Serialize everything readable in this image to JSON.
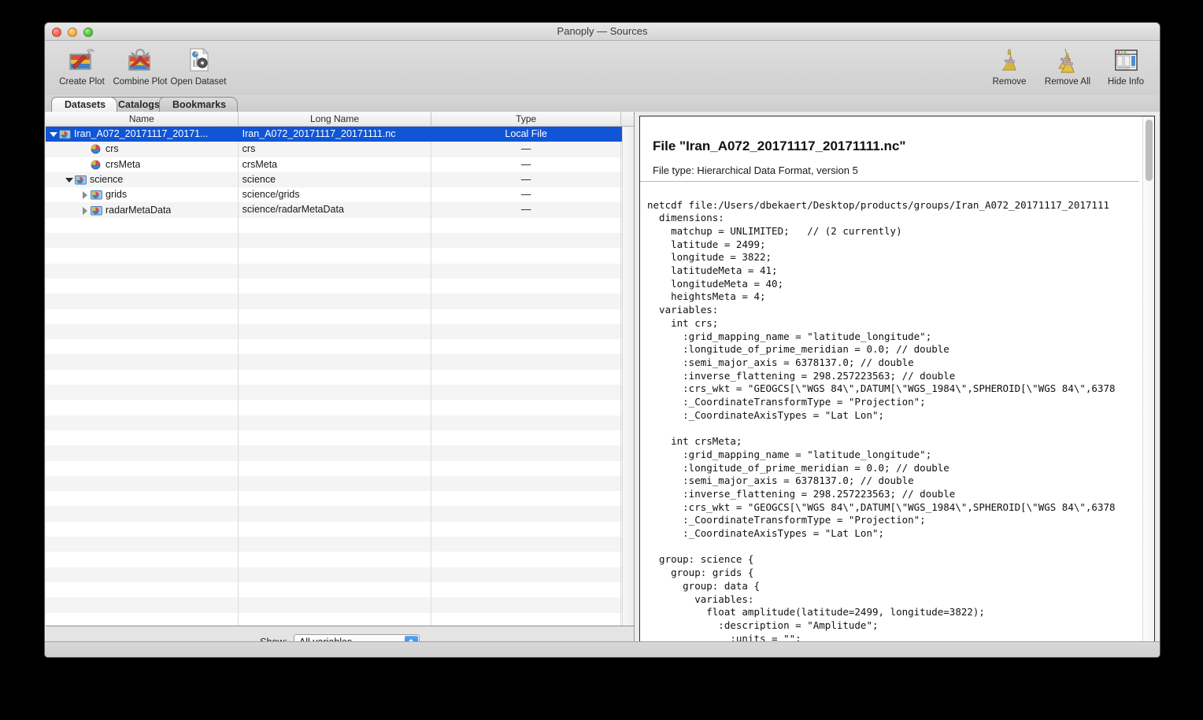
{
  "window": {
    "title": "Panoply — Sources",
    "traffic_lights": [
      "close",
      "minimize",
      "maximize"
    ]
  },
  "toolbar": {
    "left_buttons": [
      {
        "label": "Create Plot",
        "icon": "create-plot-icon"
      },
      {
        "label": "Combine Plot",
        "icon": "combine-plot-icon"
      },
      {
        "label": "Open Dataset",
        "icon": "open-dataset-icon"
      }
    ],
    "right_buttons": [
      {
        "label": "Remove",
        "icon": "broom-icon"
      },
      {
        "label": "Remove All",
        "icon": "double-broom-icon"
      },
      {
        "label": "Hide Info",
        "icon": "window-panel-icon"
      }
    ]
  },
  "tabs": [
    {
      "label": "Datasets",
      "active": true
    },
    {
      "label": "Catalogs",
      "active": false
    },
    {
      "label": "Bookmarks",
      "active": false
    }
  ],
  "table": {
    "columns": [
      "Name",
      "Long Name",
      "Type"
    ],
    "rows": [
      {
        "name": "Iran_A072_20171117_20171...",
        "long_name": "Iran_A072_20171117_20171111.nc",
        "type": "Local File",
        "depth": 0,
        "twisty": "down",
        "icon": "dataset-folder-icon",
        "selected": true
      },
      {
        "name": "crs",
        "long_name": "crs",
        "type": "—",
        "depth": 2,
        "twisty": "none",
        "icon": "variable-globe-icon",
        "selected": false
      },
      {
        "name": "crsMeta",
        "long_name": "crsMeta",
        "type": "—",
        "depth": 2,
        "twisty": "none",
        "icon": "variable-globe-icon",
        "selected": false
      },
      {
        "name": "science",
        "long_name": "science",
        "type": "—",
        "depth": 1,
        "twisty": "down",
        "icon": "group-folder-icon",
        "selected": false
      },
      {
        "name": "grids",
        "long_name": "science/grids",
        "type": "—",
        "depth": 2,
        "twisty": "right",
        "icon": "group-folder-icon",
        "selected": false
      },
      {
        "name": "radarMetaData",
        "long_name": "science/radarMetaData",
        "type": "—",
        "depth": 2,
        "twisty": "right",
        "icon": "group-folder-icon",
        "selected": false
      }
    ],
    "empty_row_count": 27
  },
  "footer": {
    "show_label": "Show:",
    "show_value": "All variables"
  },
  "info": {
    "title": "File \"Iran_A072_20171117_20171111.nc\"",
    "subtitle": "File type: Hierarchical Data Format, version 5",
    "code": "netcdf file:/Users/dbekaert/Desktop/products/groups/Iran_A072_20171117_2017111\n  dimensions:\n    matchup = UNLIMITED;   // (2 currently)\n    latitude = 2499;\n    longitude = 3822;\n    latitudeMeta = 41;\n    longitudeMeta = 40;\n    heightsMeta = 4;\n  variables:\n    int crs;\n      :grid_mapping_name = \"latitude_longitude\";\n      :longitude_of_prime_meridian = 0.0; // double\n      :semi_major_axis = 6378137.0; // double\n      :inverse_flattening = 298.257223563; // double\n      :crs_wkt = \"GEOGCS[\\\"WGS 84\\\",DATUM[\\\"WGS_1984\\\",SPHEROID[\\\"WGS 84\\\",6378\n      :_CoordinateTransformType = \"Projection\";\n      :_CoordinateAxisTypes = \"Lat Lon\";\n\n    int crsMeta;\n      :grid_mapping_name = \"latitude_longitude\";\n      :longitude_of_prime_meridian = 0.0; // double\n      :semi_major_axis = 6378137.0; // double\n      :inverse_flattening = 298.257223563; // double\n      :crs_wkt = \"GEOGCS[\\\"WGS 84\\\",DATUM[\\\"WGS_1984\\\",SPHEROID[\\\"WGS 84\\\",6378\n      :_CoordinateTransformType = \"Projection\";\n      :_CoordinateAxisTypes = \"Lat Lon\";\n\n  group: science {\n    group: grids {\n      group: data {\n        variables:\n          float amplitude(latitude=2499, longitude=3822);\n            :description = \"Amplitude\";\n              :units = \"\";"
  },
  "colors": {
    "selection_blue": "#1055d6",
    "window_chrome": "#ececec",
    "row_stripe": "#f4f4f4",
    "stepper_blue": "#1a6ede"
  }
}
